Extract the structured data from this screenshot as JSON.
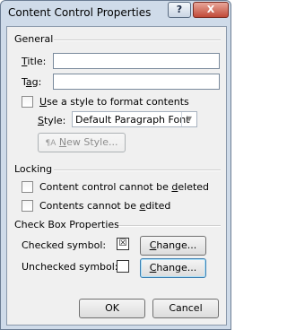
{
  "window": {
    "title": "Content Control Properties",
    "help_glyph": "?",
    "close_glyph": "X"
  },
  "general": {
    "heading": "General",
    "title_label": {
      "pre": "",
      "key": "T",
      "post": "itle:"
    },
    "tag_label": {
      "pre": "T",
      "key": "a",
      "post": "g:"
    },
    "title_value": "",
    "tag_value": "",
    "use_style_label": {
      "pre": "",
      "key": "U",
      "post": "se a style to format contents"
    },
    "use_style_checked": false,
    "style_label": {
      "pre": "",
      "key": "S",
      "post": "tyle:"
    },
    "style_value": "Default Paragraph Font",
    "new_style_button": {
      "pre": "",
      "key": "N",
      "post": "ew Style...",
      "icon": "new-style-icon",
      "enabled": false
    }
  },
  "locking": {
    "heading": "Locking",
    "delete_lock": {
      "pre": "Content control cannot be ",
      "key": "d",
      "post": "eleted",
      "checked": false
    },
    "edit_lock": {
      "pre": "Contents cannot be ",
      "key": "e",
      "post": "dited",
      "checked": false
    }
  },
  "checkbox_props": {
    "heading": "Check Box Properties",
    "checked_label": "Checked symbol:",
    "checked_symbol": "☒",
    "unchecked_label": "Unchecked symbol:",
    "unchecked_symbol": "",
    "change_label": {
      "pre": "",
      "key": "C",
      "post": "hange..."
    }
  },
  "footer": {
    "ok": "OK",
    "cancel": "Cancel"
  }
}
